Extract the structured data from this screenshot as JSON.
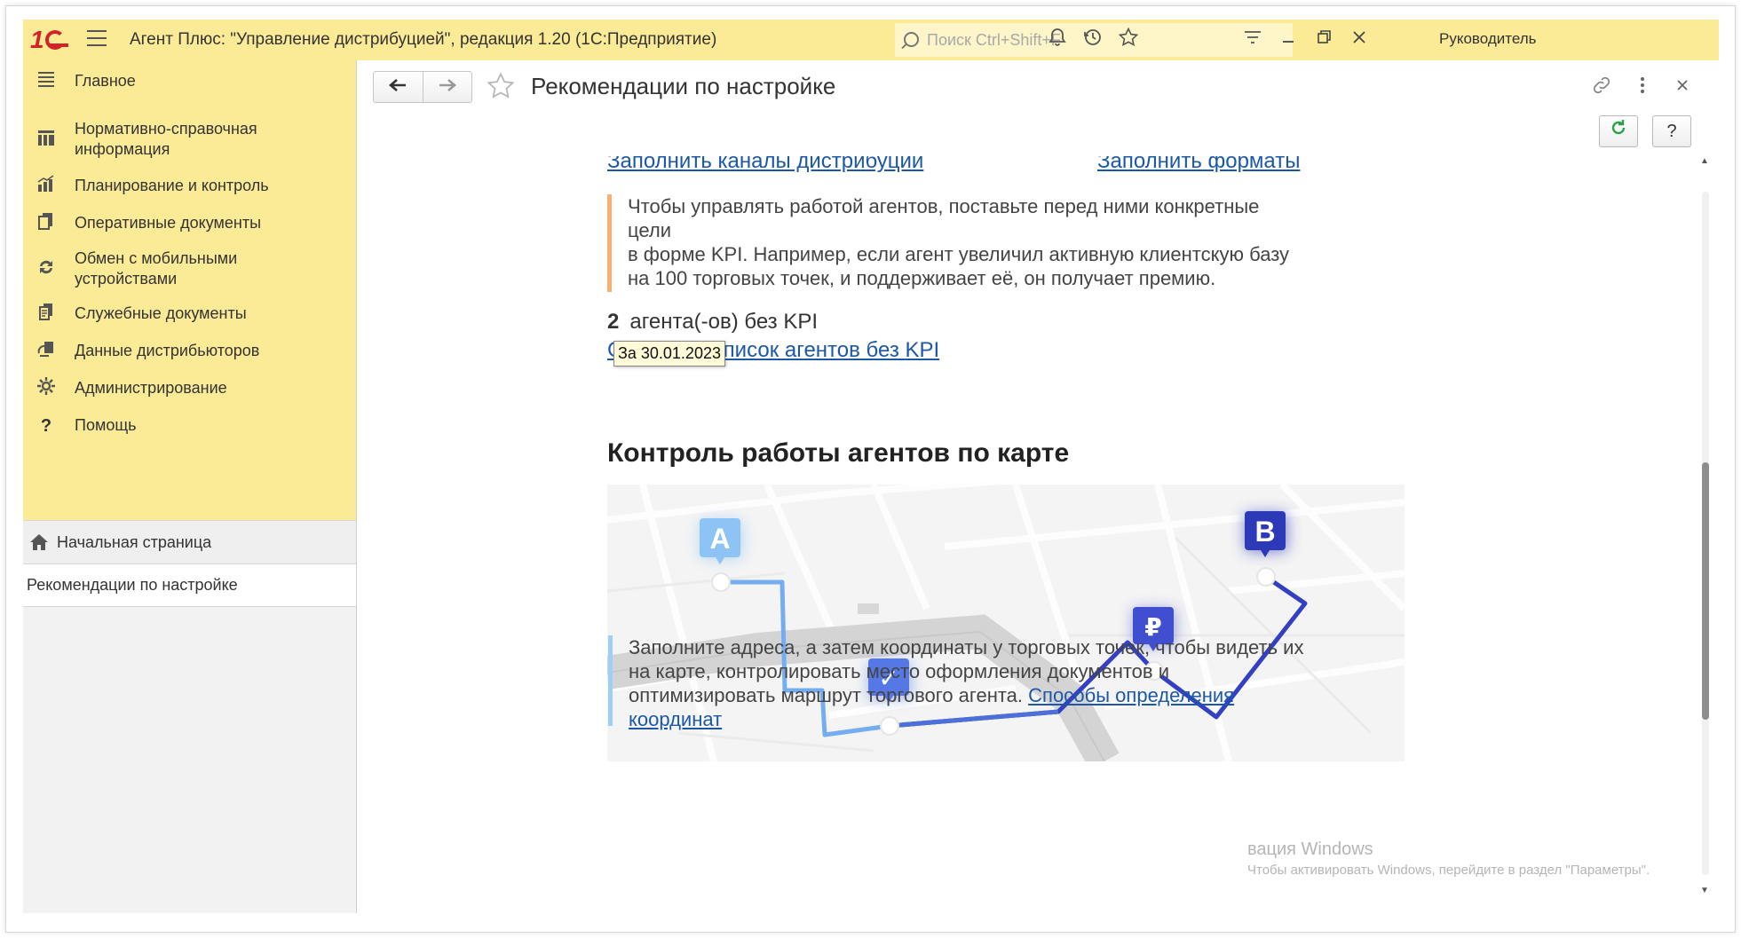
{
  "window": {
    "title": "Агент Плюс: \"Управление дистрибуцией\", редакция 1.20  (1С:Предприятие)",
    "search_placeholder": "Поиск Ctrl+Shift+F",
    "user": "Руководитель"
  },
  "sidebar": {
    "items": [
      {
        "label": "Главное",
        "icon": "menu-lines-icon"
      },
      {
        "label": "Нормативно-справочная информация",
        "icon": "bars-grid-icon"
      },
      {
        "label": "Планирование и контроль",
        "icon": "bar-chart-icon"
      },
      {
        "label": "Оперативные документы",
        "icon": "documents-icon"
      },
      {
        "label": "Обмен с мобильными устройствами",
        "icon": "sync-icon"
      },
      {
        "label": "Служебные документы",
        "icon": "service-docs-icon"
      },
      {
        "label": "Данные дистрибьюторов",
        "icon": "distributor-data-icon"
      },
      {
        "label": "Администрирование",
        "icon": "gear-icon"
      },
      {
        "label": "Помощь",
        "icon": "question-icon"
      }
    ],
    "home": "Начальная страница",
    "active_tab": "Рекомендации по настройке"
  },
  "page": {
    "title": "Рекомендации по настройке",
    "top_links": [
      "Заполнить каналы дистрибуции",
      "Заполнить форматы"
    ],
    "kpi_note": [
      "Чтобы управлять работой агентов, поставьте перед ними конкретные",
      "цели",
      "в форме KPI. Например, если агент увеличил активную клиентскую базу",
      "на 100 торговых точек, и поддерживает её, он получает премию."
    ],
    "kpi_count": "2",
    "kpi_text": "агента(-ов) без KPI",
    "kpi_link": "Список агентов без KPI",
    "kpi_link_prefix": "С",
    "tooltip": "За 30.01.2023",
    "section_title": "Контроль работы агентов по карте",
    "map_markers": {
      "start": "A",
      "end": "B",
      "payment": "₽",
      "check": "✓"
    },
    "map_note": [
      "Заполните адреса, а затем координаты у торговых точек, чтобы видеть их",
      "на карте, контролировать место оформления документов и",
      "оптимизировать маршрут торгового агента. "
    ],
    "map_link": [
      "Способы определения",
      "координат"
    ]
  },
  "watermark": {
    "line1": "вация Windows",
    "line2": "Чтобы активировать Windows, перейдите в раздел \"Параметры\"."
  },
  "colors": {
    "titlebar": "#fbeb96",
    "link": "#1c58a8",
    "note_orange": "#f9b06e",
    "note_blue": "#9ecff4",
    "route_light": "#74aef0",
    "route_dark": "#3340c4"
  }
}
